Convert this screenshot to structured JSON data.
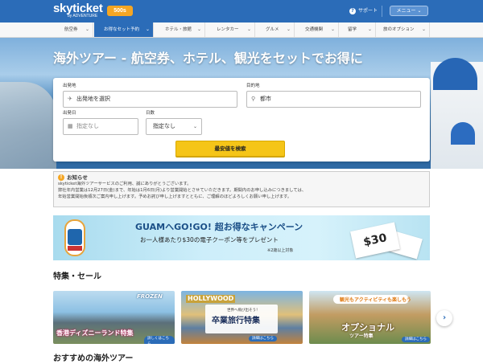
{
  "header": {
    "logo": "skyticket",
    "logo_sub": "by ADVENTURE",
    "badge": "500s",
    "support": "サポート",
    "menu": "メニュー"
  },
  "nav": {
    "items": [
      {
        "label": "航空券",
        "active": false
      },
      {
        "label": "お得なセット予約",
        "active": true
      },
      {
        "label": "ホテル・旅館",
        "active": false
      },
      {
        "label": "レンタカー",
        "active": false
      },
      {
        "label": "グルメ",
        "active": false
      },
      {
        "label": "交通機関",
        "active": false
      },
      {
        "label": "留学",
        "active": false
      },
      {
        "label": "旅のオプション",
        "active": false
      }
    ]
  },
  "hero": {
    "title": "海外ツアー - 航空券、ホテル、観光をセットでお得に"
  },
  "search": {
    "origin_label": "出発地",
    "origin_value": "出発地を選択",
    "dest_label": "目的地",
    "dest_placeholder": "都市",
    "date_label": "出発日",
    "date_value": "指定なし",
    "days_label": "日数",
    "days_value": "指定なし",
    "submit": "最安値を検索"
  },
  "notice": {
    "title": "お知らせ",
    "lines": [
      "skyticket海外ツアーサービスのご利用、誠にありがとうございます。",
      "弊社年内営業は12月27日(金)まで、年始は1月6日(月)より営業開始とさせていただきます。期間内のお申し込みにつきましては、",
      "年始営業開始後順次ご案内申し上げます。予めお詫び申し上げますとともに、ご理解のほどよろしくお願い申し上げます。"
    ]
  },
  "banner": {
    "headline": "GUAMへGO!GO! 超お得なキャンペーン",
    "sub": "お一人様あたり$30の電子クーポン等をプレゼント",
    "note": "※2歳以上対象",
    "ticket": "$30"
  },
  "features": {
    "title": "特集・セール",
    "cards": [
      {
        "brand": "FROZEN",
        "caption": "香港ディズニーランド特集",
        "more": "詳しくはこちら"
      },
      {
        "brand": "HOLLYWOOD",
        "top": "世界へ飛び出そう！",
        "caption": "卒業旅行特集",
        "more": "詳細はこちら"
      },
      {
        "top": "観光もアクティビティも楽しもう",
        "caption": "オプショナル",
        "sub": "ツアー特集",
        "more": "詳細はこちら"
      }
    ],
    "next": "›"
  },
  "recommend": {
    "title": "おすすめの海外ツアー"
  },
  "colors": {
    "brand_blue": "#2b6cb8",
    "accent_yellow": "#f5c518",
    "badge_orange": "#f5a623"
  }
}
